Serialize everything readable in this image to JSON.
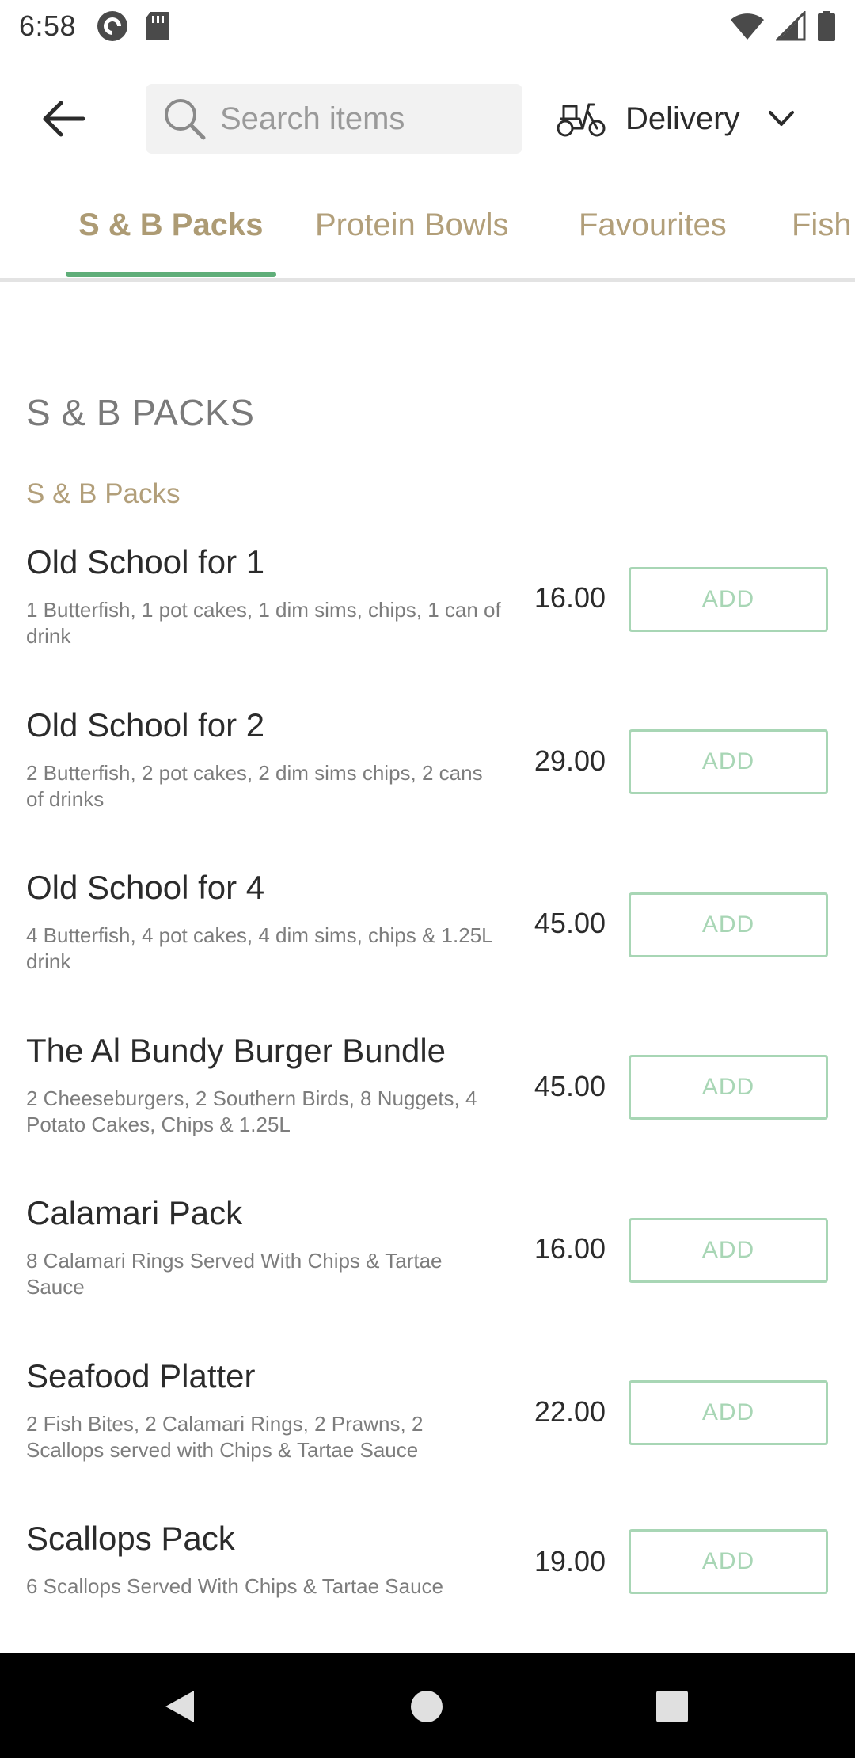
{
  "status_bar": {
    "time": "6:58"
  },
  "search": {
    "placeholder": "Search items"
  },
  "delivery": {
    "label": "Delivery"
  },
  "tabs": [
    {
      "label": "S & B Packs",
      "active": true
    },
    {
      "label": "Protein Bowls",
      "active": false
    },
    {
      "label": "Favourites",
      "active": false
    },
    {
      "label": "Fish",
      "active": false
    }
  ],
  "section": {
    "title": "S & B PACKS",
    "subtitle": "S & B Packs"
  },
  "items": [
    {
      "name": "Old School for 1",
      "desc": "1 Butterfish, 1 pot cakes, 1 dim sims, chips, 1 can of drink",
      "price": "16.00",
      "add": "ADD"
    },
    {
      "name": "Old School for 2",
      "desc": "2 Butterfish, 2 pot cakes, 2 dim sims chips, 2 cans of drinks",
      "price": "29.00",
      "add": "ADD"
    },
    {
      "name": "Old School for 4",
      "desc": "4 Butterfish, 4 pot cakes, 4 dim sims, chips & 1.25L drink",
      "price": "45.00",
      "add": "ADD"
    },
    {
      "name": "The Al Bundy Burger Bundle",
      "desc": "2 Cheeseburgers, 2 Southern Birds, 8 Nuggets, 4 Potato Cakes, Chips & 1.25L",
      "price": "45.00",
      "add": "ADD"
    },
    {
      "name": "Calamari Pack",
      "desc": "8 Calamari Rings Served With Chips & Tartae Sauce",
      "price": "16.00",
      "add": "ADD"
    },
    {
      "name": "Seafood Platter",
      "desc": "2 Fish Bites, 2 Calamari Rings, 2 Prawns, 2 Scallops served with Chips & Tartae Sauce",
      "price": "22.00",
      "add": "ADD"
    },
    {
      "name": "Scallops Pack",
      "desc": "6 Scallops Served With Chips & Tartae Sauce",
      "price": "19.00",
      "add": "ADD"
    }
  ],
  "colors": {
    "accent_green": "#5fae79",
    "tab_gold": "#b29f7a",
    "add_border": "#a8d6b5"
  },
  "icons": [
    "back-arrow-icon",
    "search-icon",
    "scooter-icon",
    "chevron-down-icon"
  ]
}
